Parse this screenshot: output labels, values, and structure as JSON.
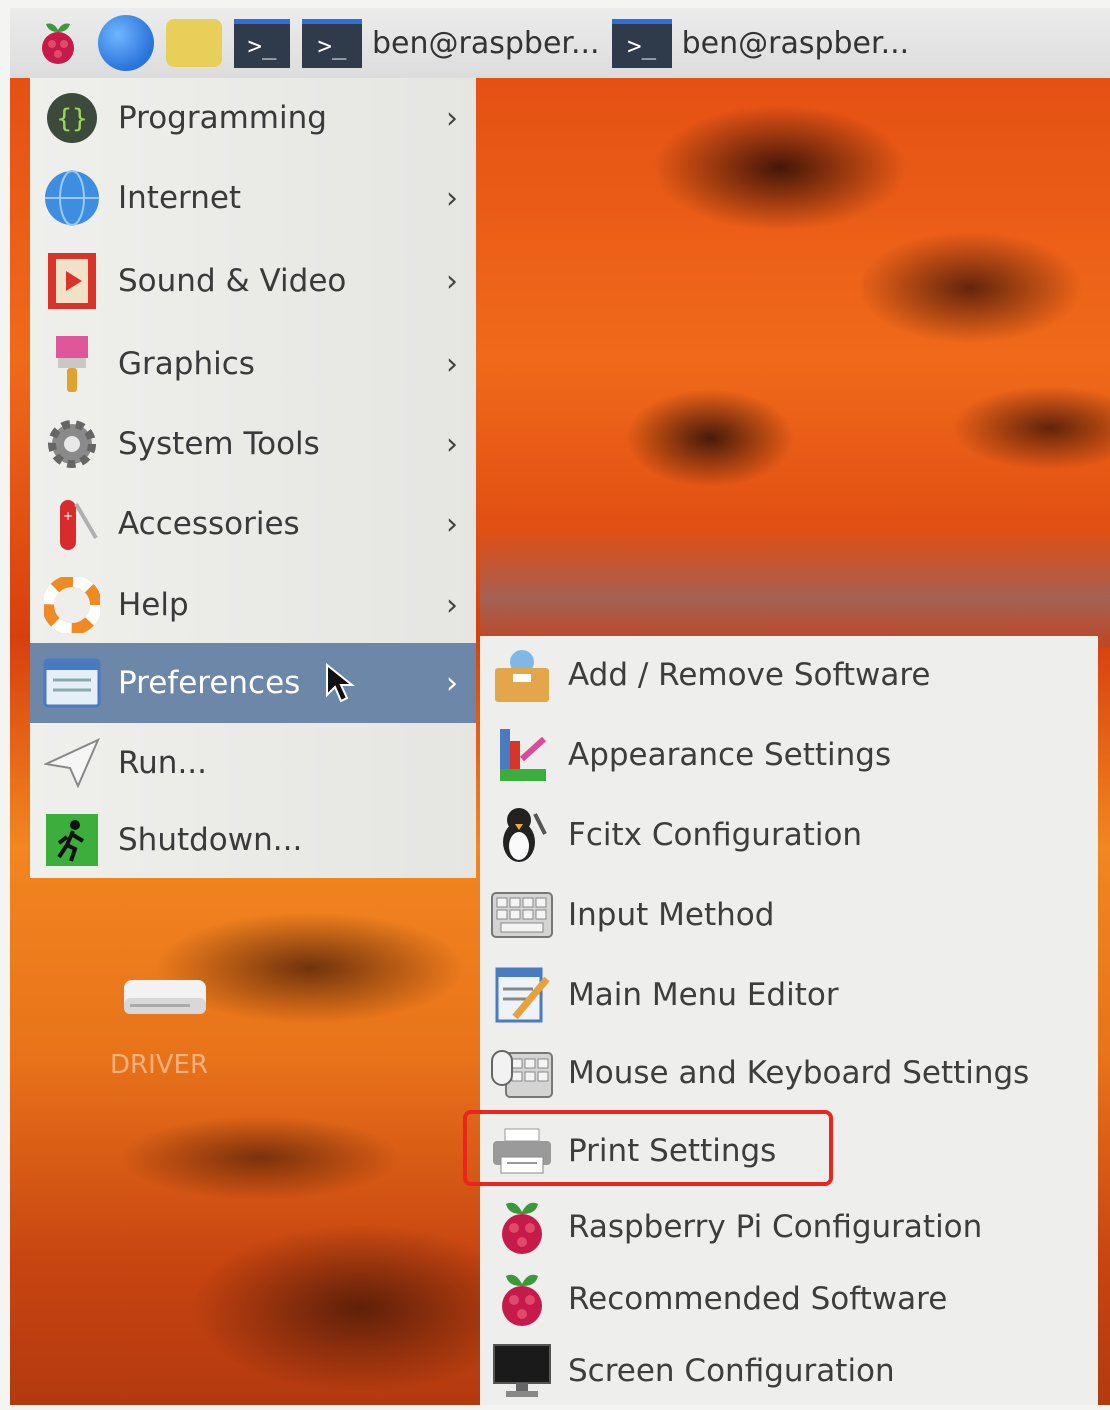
{
  "panel": {
    "tasks": [
      {
        "label": "ben@raspber..."
      },
      {
        "label": "ben@raspber..."
      }
    ],
    "icons": [
      "raspberry-menu-icon",
      "web-browser-icon",
      "file-manager-icon",
      "terminal-icon"
    ]
  },
  "main_menu": {
    "items": [
      {
        "label": "Programming",
        "icon": "programming-icon",
        "has_submenu": true
      },
      {
        "label": "Internet",
        "icon": "globe-icon",
        "has_submenu": true
      },
      {
        "label": "Sound & Video",
        "icon": "sound-video-icon",
        "has_submenu": true
      },
      {
        "label": "Graphics",
        "icon": "paintbrush-icon",
        "has_submenu": true
      },
      {
        "label": "System Tools",
        "icon": "gear-icon",
        "has_submenu": true
      },
      {
        "label": "Accessories",
        "icon": "pocket-knife-icon",
        "has_submenu": true
      },
      {
        "label": "Help",
        "icon": "lifebuoy-icon",
        "has_submenu": true
      },
      {
        "label": "Preferences",
        "icon": "preferences-icon",
        "has_submenu": true,
        "active": true
      },
      {
        "label": "Run...",
        "icon": "paper-plane-icon",
        "has_submenu": false
      },
      {
        "label": "Shutdown...",
        "icon": "exit-icon",
        "has_submenu": false
      }
    ]
  },
  "submenu": {
    "items": [
      {
        "label": "Add / Remove Software",
        "icon": "package-icon"
      },
      {
        "label": "Appearance Settings",
        "icon": "appearance-icon"
      },
      {
        "label": "Fcitx Configuration",
        "icon": "penguin-icon"
      },
      {
        "label": "Input Method",
        "icon": "keyboard-icon"
      },
      {
        "label": "Main Menu Editor",
        "icon": "menu-editor-icon"
      },
      {
        "label": "Mouse and Keyboard Settings",
        "icon": "mouse-keyboard-icon"
      },
      {
        "label": "Print Settings",
        "icon": "printer-icon",
        "highlighted": true
      },
      {
        "label": "Raspberry Pi Configuration",
        "icon": "raspberry-icon"
      },
      {
        "label": "Recommended Software",
        "icon": "raspberry-icon"
      },
      {
        "label": "Screen Configuration",
        "icon": "monitor-icon"
      }
    ]
  },
  "desktop": {
    "drive_label": "DRIVER"
  },
  "colors": {
    "menu_bg": "#efefec",
    "active_item": "#6d87a8",
    "highlight_border": "#e8261f"
  }
}
